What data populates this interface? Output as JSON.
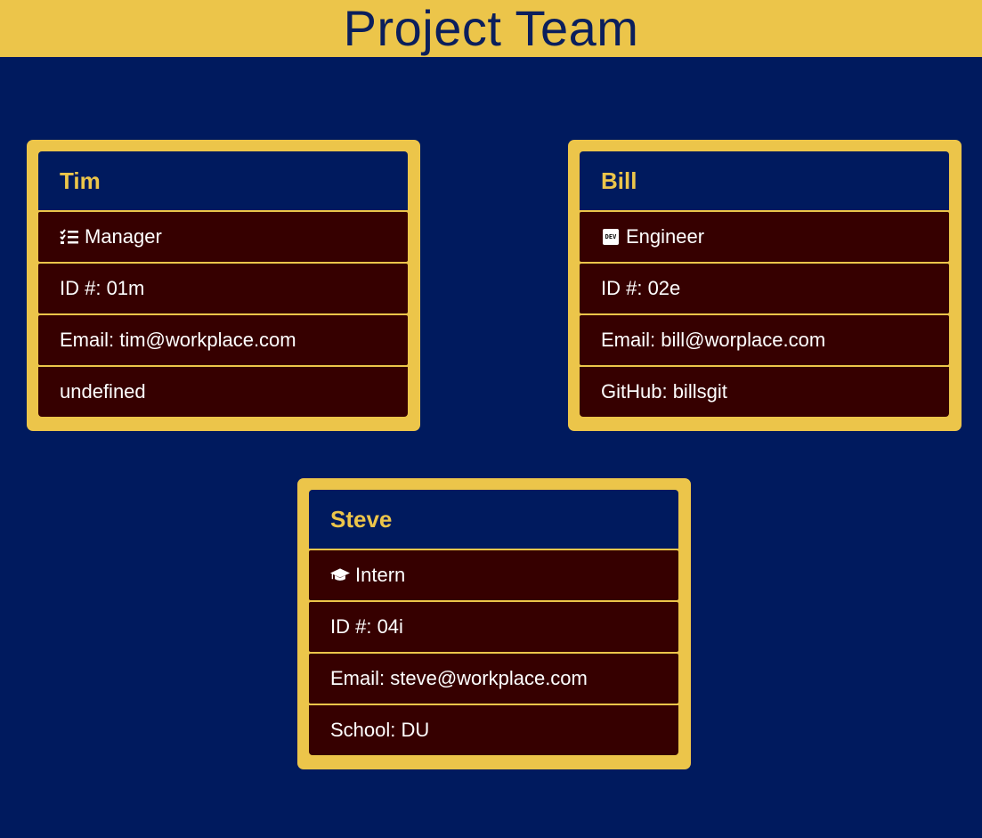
{
  "header": {
    "title": "Project Team"
  },
  "colors": {
    "background": "#001a5e",
    "accent": "#ecc54a",
    "row_bg": "#360000",
    "text": "#ffffff"
  },
  "cards": [
    {
      "name": "Tim",
      "role": "Manager",
      "role_icon": "task-list-icon",
      "id_line": "ID #: 01m",
      "email_line": "Email: tim@workplace.com",
      "extra_line": "undefined"
    },
    {
      "name": "Bill",
      "role": "Engineer",
      "role_icon": "dev-badge-icon",
      "role_icon_text": "DEV",
      "id_line": "ID #: 02e",
      "email_line": "Email: bill@worplace.com",
      "extra_line": "GitHub: billsgit"
    },
    {
      "name": "Steve",
      "role": "Intern",
      "role_icon": "graduation-cap-icon",
      "id_line": "ID #: 04i",
      "email_line": "Email: steve@workplace.com",
      "extra_line": "School: DU"
    }
  ]
}
